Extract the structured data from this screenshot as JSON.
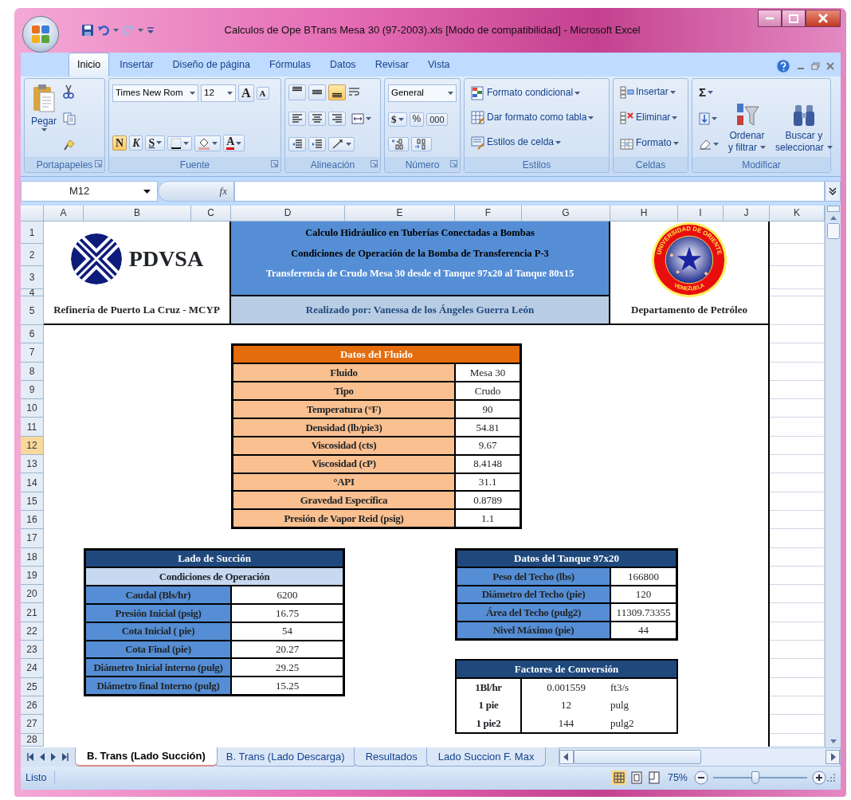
{
  "window": {
    "title": "Calculos de Ope BTrans Mesa 30 (97-2003).xls  [Modo de compatibilidad] - Microsoft Excel"
  },
  "ribbon_tabs": [
    {
      "label": "Inicio",
      "selected": true
    },
    {
      "label": "Insertar",
      "selected": false
    },
    {
      "label": "Diseño de página",
      "selected": false
    },
    {
      "label": "Fórmulas",
      "selected": false
    },
    {
      "label": "Datos",
      "selected": false
    },
    {
      "label": "Revisar",
      "selected": false
    },
    {
      "label": "Vista",
      "selected": false
    }
  ],
  "ribbon": {
    "clipboard": {
      "label": "Portapapeles",
      "paste": "Pegar"
    },
    "font": {
      "label": "Fuente",
      "name": "Times New Rom",
      "size": "12",
      "grow": "A",
      "shrink": "A",
      "color_letter": "A",
      "styles": [
        {
          "label": "N",
          "on": true
        },
        {
          "label": "K",
          "on": false
        },
        {
          "label": "S",
          "on": false
        }
      ]
    },
    "alignment": {
      "label": "Alineación",
      "vertical": [
        {
          "on": false
        },
        {
          "on": false
        },
        {
          "on": true
        }
      ]
    },
    "number": {
      "label": "Número",
      "format": "General",
      "currency": "$",
      "percent": "%",
      "thousands": "000"
    },
    "styles": {
      "label": "Estilos",
      "buttons": [
        "Formato condicional",
        "Dar formato como tabla",
        "Estilos de celda"
      ]
    },
    "cells": {
      "label": "Celdas",
      "buttons": [
        "Insertar",
        "Eliminar",
        "Formato"
      ]
    },
    "editing": {
      "label": "Modificar",
      "sum": "Σ",
      "sort": [
        "Ordenar",
        "y filtrar"
      ],
      "find": [
        "Buscar y",
        "seleccionar"
      ]
    }
  },
  "formula_bar": {
    "cell": "M12",
    "fx": "fx"
  },
  "sheet": {
    "columns": [
      "A",
      "B",
      "C",
      "D",
      "E",
      "F",
      "G",
      "H",
      "I",
      "J",
      "K"
    ],
    "rows": [
      {
        "label": "1",
        "selected": false
      },
      {
        "label": "2",
        "selected": false
      },
      {
        "label": "3",
        "selected": false
      },
      {
        "label": "4",
        "selected": false
      },
      {
        "label": "5",
        "selected": false
      },
      {
        "label": "6",
        "selected": false
      },
      {
        "label": "7",
        "selected": false
      },
      {
        "label": "8",
        "selected": false
      },
      {
        "label": "9",
        "selected": false
      },
      {
        "label": "10",
        "selected": false
      },
      {
        "label": "11",
        "selected": false
      },
      {
        "label": "12",
        "selected": true
      },
      {
        "label": "13",
        "selected": false
      },
      {
        "label": "14",
        "selected": false
      },
      {
        "label": "15",
        "selected": false
      },
      {
        "label": "16",
        "selected": false
      },
      {
        "label": "17",
        "selected": false
      },
      {
        "label": "18",
        "selected": false
      },
      {
        "label": "19",
        "selected": false
      },
      {
        "label": "20",
        "selected": false
      },
      {
        "label": "21",
        "selected": false
      },
      {
        "label": "22",
        "selected": false
      },
      {
        "label": "23",
        "selected": false
      },
      {
        "label": "24",
        "selected": false
      },
      {
        "label": "25",
        "selected": false
      },
      {
        "label": "26",
        "selected": false
      },
      {
        "label": "27",
        "selected": false
      },
      {
        "label": "28",
        "selected": false
      }
    ]
  },
  "header": {
    "logo_text": "PDVSA",
    "left_caption": "Refinería de Puerto La Cruz - MCYP",
    "titles": [
      "Calculo Hidráulico en Tuberías Conectadas a Bombas",
      "Condiciones de Operación de la Bomba de Transferencia P-3",
      "Transferencia de Crudo Mesa 30 desde el Tanque 97x20 al Tanque 80x15"
    ],
    "author": "Realizado por: Vanessa de los Ángeles Guerra León",
    "seal_texts": [
      "UNIVERSIDAD DE ORIENTE",
      "VENEZUELA"
    ],
    "right_caption": "Departamento de Petróleo"
  },
  "fluid_table": {
    "title": "Datos del Fluido",
    "rows": [
      {
        "label": "Fluido",
        "value": "Mesa 30"
      },
      {
        "label": "Tipo",
        "value": "Crudo"
      },
      {
        "label": "Temperatura (°F)",
        "value": "90"
      },
      {
        "label": "Densidad (lb/pie3)",
        "value": "54.81"
      },
      {
        "label": "Viscosidad (cts)",
        "value": "9.67"
      },
      {
        "label": "Viscosidad (cP)",
        "value": "8.4148"
      },
      {
        "label": "°API",
        "value": "31.1"
      },
      {
        "label": "Gravedad Específica",
        "value": "0.8789"
      },
      {
        "label": "Presión de Vapor Reid (psig)",
        "value": "1.1"
      }
    ]
  },
  "suction_table": {
    "title": "Lado de Succión",
    "subtitle": "Condiciones de Operación",
    "rows": [
      {
        "label": "Caudal (Bls/hr)",
        "value": "6200"
      },
      {
        "label": "Presión Inicial (psig)",
        "value": "16.75"
      },
      {
        "label": "Cota Inicial ( pie)",
        "value": "54"
      },
      {
        "label": "Cota Final (pie)",
        "value": "20.27"
      },
      {
        "label": "Diámetro Inicial interno (pulg)",
        "value": "29.25"
      },
      {
        "label": "Diámetro final Interno (pulg)",
        "value": "15.25"
      }
    ]
  },
  "tank_table": {
    "title": "Datos del Tanque 97x20",
    "rows": [
      {
        "label": "Peso del Techo (lbs)",
        "value": "166800"
      },
      {
        "label": "Diámetro del Techo (pie)",
        "value": "120"
      },
      {
        "label": "Área del Techo (pulg2)",
        "value": "11309.73355"
      },
      {
        "label": "Nivel Máximo (pie)",
        "value": "44"
      }
    ]
  },
  "conversion_table": {
    "title": "Factores de Conversión",
    "rows": [
      {
        "unit": "1Bl/hr",
        "factor": "0.001559",
        "target": "ft3/s"
      },
      {
        "unit": "1 pie",
        "factor": "12",
        "target": "pulg"
      },
      {
        "unit": "1 pie2",
        "factor": "144",
        "target": "pulg2"
      }
    ]
  },
  "sheet_tabs": [
    {
      "label": "B. Trans (Lado Succión)",
      "selected": true
    },
    {
      "label": "B. Trans (Lado Descarga)",
      "selected": false
    },
    {
      "label": "Resultados",
      "selected": false
    },
    {
      "label": "Lado Succion F. Max",
      "selected": false
    }
  ],
  "status_bar": {
    "text": "Listo",
    "zoom": "75%",
    "zoom_slider": {
      "level": 0.45
    }
  }
}
